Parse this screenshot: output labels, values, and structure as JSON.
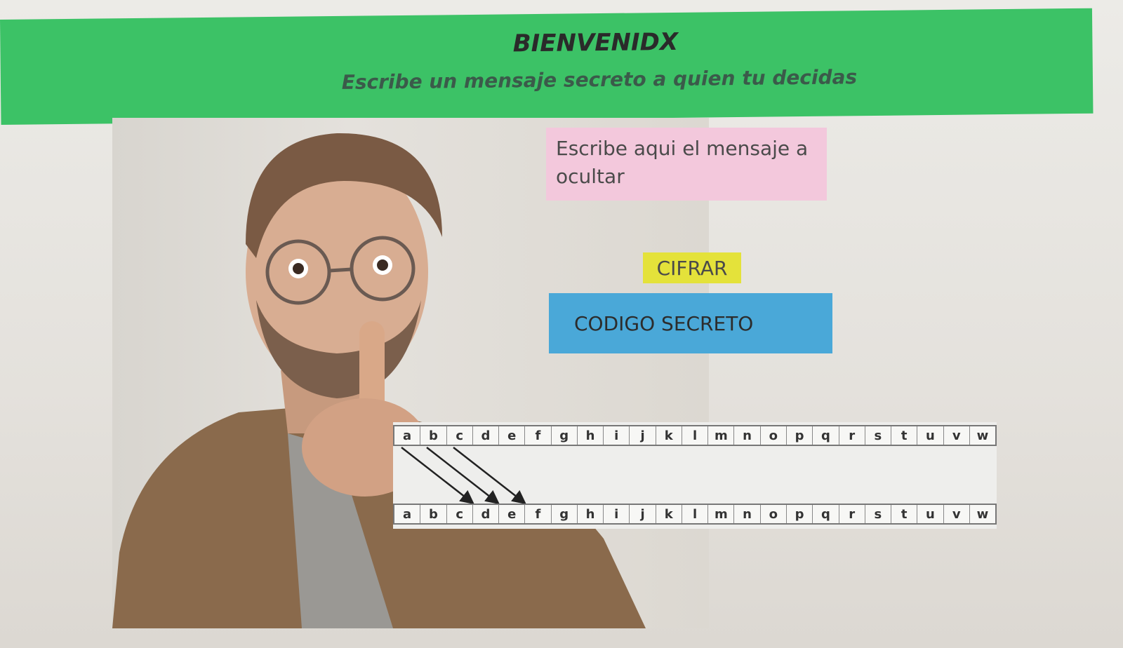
{
  "header": {
    "title": "BIENVENIDX",
    "subtitle": "Escribe un mensaje secreto a quien tu decidas",
    "bg_color": "#3cc266"
  },
  "message": {
    "placeholder": "Escribe aqui el mensaje a ocultar",
    "value": "",
    "bg_color": "#f3c8dc"
  },
  "actions": {
    "cifrar_label": "CIFRAR",
    "cifrar_color": "#e4e23a",
    "codigo_label": "CODIGO SECRETO",
    "codigo_color": "#4aa8d8"
  },
  "cipher": {
    "top_row": [
      "a",
      "b",
      "c",
      "d",
      "e",
      "f",
      "g",
      "h",
      "i",
      "j",
      "k",
      "l",
      "m",
      "n",
      "o",
      "p",
      "q",
      "r",
      "s",
      "t",
      "u",
      "v",
      "w"
    ],
    "bottom_row": [
      "a",
      "b",
      "c",
      "d",
      "e",
      "f",
      "g",
      "h",
      "i",
      "j",
      "k",
      "l",
      "m",
      "n",
      "o",
      "p",
      "q",
      "r",
      "s",
      "t",
      "u",
      "v",
      "w"
    ],
    "shift": 3
  }
}
